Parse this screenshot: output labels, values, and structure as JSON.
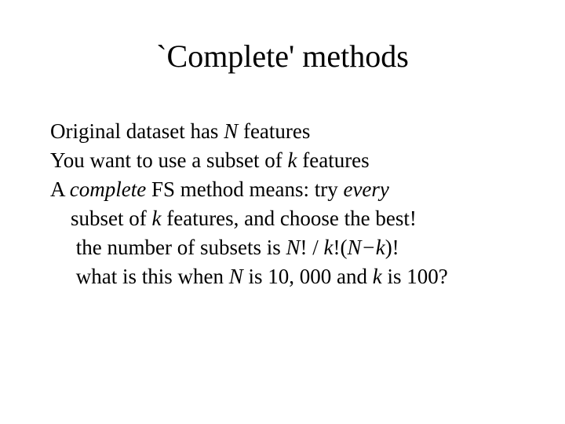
{
  "title": "`Complete' methods",
  "lines": {
    "l1a": "Original dataset has ",
    "l1b": "N",
    "l1c": " features",
    "l2a": "You want to use a subset of ",
    "l2b": "k",
    "l2c": " features",
    "l3a": "A ",
    "l3b": "complete",
    "l3c": " FS method means:  try ",
    "l3d": "every",
    "l4a": "subset of ",
    "l4b": "k",
    "l4c": " features, and choose the best!",
    "l5a": "the number of subsets is ",
    "l5b": "N",
    "l5c": "! / ",
    "l5d": "k",
    "l5e": "!(",
    "l5f": "N−k",
    "l5g": ")!",
    "l6a": "what is this when ",
    "l6b": "N",
    "l6c": " is 10, 000 and ",
    "l6d": "k",
    "l6e": " is 100?"
  }
}
